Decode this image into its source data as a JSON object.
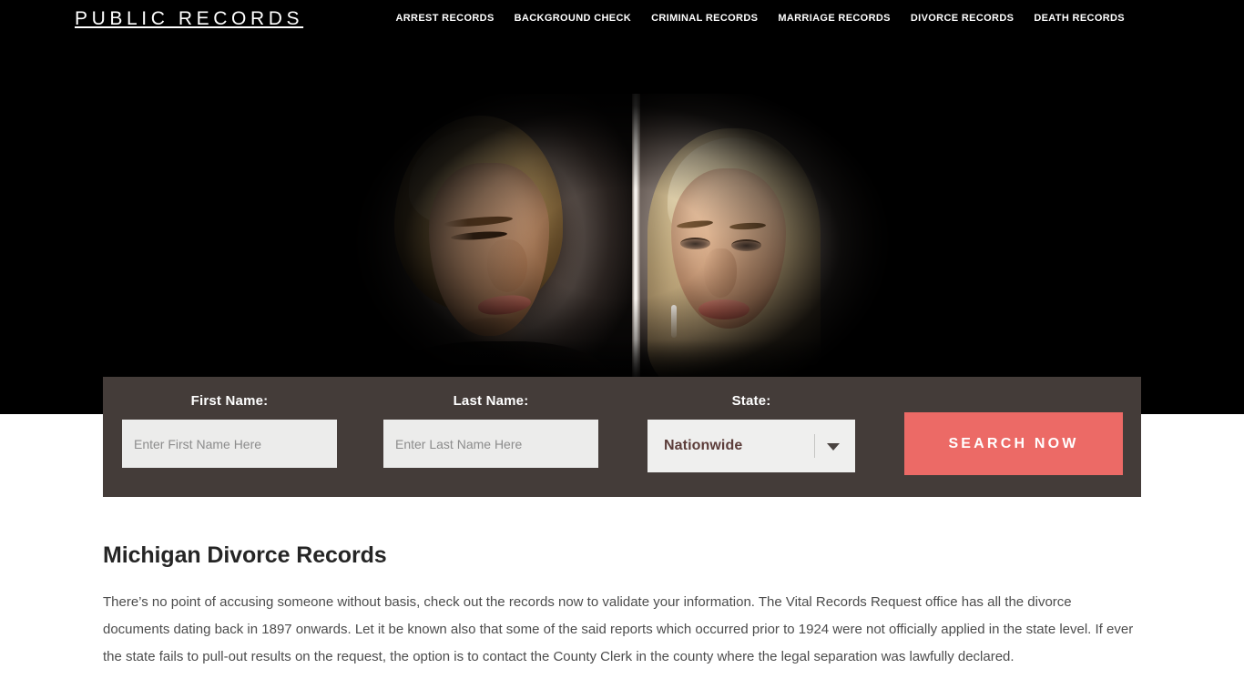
{
  "site": {
    "logo": "PUBLIC RECORDS"
  },
  "nav": {
    "items": [
      {
        "label": "ARREST RECORDS"
      },
      {
        "label": "BACKGROUND CHECK"
      },
      {
        "label": "CRIMINAL RECORDS"
      },
      {
        "label": "MARRIAGE RECORDS"
      },
      {
        "label": "DIVORCE RECORDS"
      },
      {
        "label": "DEATH RECORDS"
      }
    ]
  },
  "hero": {
    "image_alt": "Sad couple separated by a vertical divider, divorce themed photo"
  },
  "search_form": {
    "first_name": {
      "label": "First Name:",
      "placeholder": "Enter First Name Here",
      "value": ""
    },
    "last_name": {
      "label": "Last Name:",
      "placeholder": "Enter Last Name Here",
      "value": ""
    },
    "state": {
      "label": "State:",
      "selected": "Nationwide"
    },
    "submit_label": "SEARCH NOW"
  },
  "main": {
    "title": "Michigan Divorce Records",
    "paragraph_1": "There’s no point of accusing someone without basis, check out the records now to validate your information. The Vital Records Request office has all the divorce documents dating back in 1897 onwards. Let it be known also that some of the said reports which occurred prior to 1924 were not officially applied in the state level. If ever the state fails to pull-out results on the request, the option is to contact the County Clerk in the county where the legal separation was lawfully declared."
  },
  "colors": {
    "header_bg": "#000000",
    "panel_bg": "#443c39",
    "accent_button": "#ec6a66",
    "input_bg": "#ececeb",
    "select_text": "#5c3d3a",
    "body_text": "#4c4c4c",
    "title_text": "#252525"
  }
}
